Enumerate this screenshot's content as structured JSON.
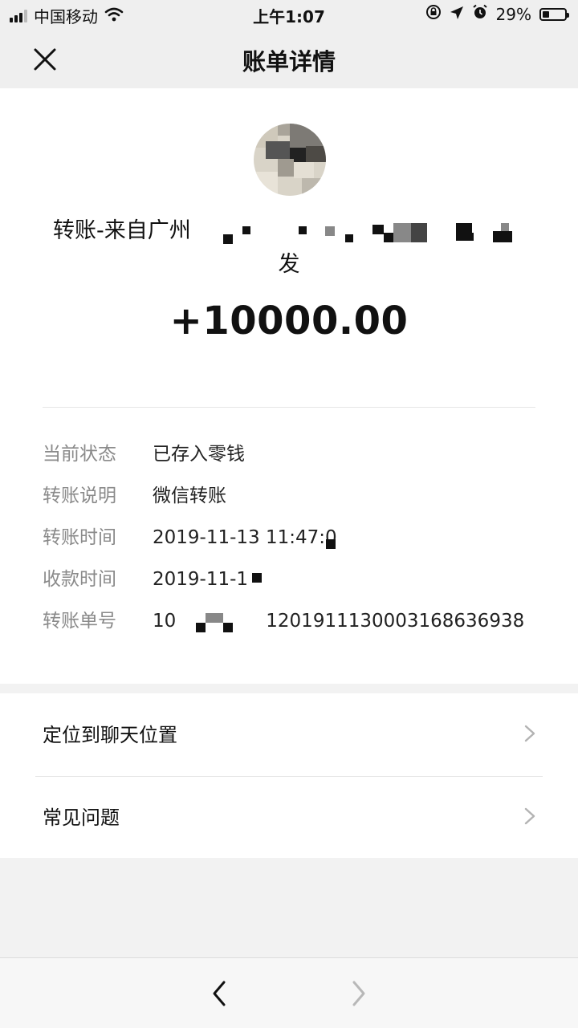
{
  "status_bar": {
    "carrier": "中国移动",
    "time": "上午1:07",
    "battery_percent": "29%",
    "battery_level": 0.29
  },
  "header": {
    "title": "账单详情"
  },
  "transfer": {
    "sender_visible": "转账-来自广州",
    "sender_line2": "发",
    "amount": "+10000.00"
  },
  "details": [
    {
      "label": "当前状态",
      "value": "已存入零钱"
    },
    {
      "label": "转账说明",
      "value": "微信转账"
    },
    {
      "label": "转账时间",
      "value": "2019-11-13 11:47:0"
    },
    {
      "label": "收款时间",
      "value": "2019-11-1"
    },
    {
      "label": "转账单号",
      "value_prefix": "10",
      "value_suffix": "1201911130003168636938"
    }
  ],
  "menu": [
    {
      "label": "定位到聊天位置"
    },
    {
      "label": "常见问题"
    }
  ],
  "colors": {
    "background": "#f2f2f2",
    "card": "#ffffff",
    "label_gray": "#8a8a8a",
    "text": "#111111"
  },
  "icons": [
    "signal-icon",
    "wifi-icon",
    "lock-rotation-icon",
    "location-icon",
    "alarm-icon",
    "battery-icon",
    "close-icon",
    "chevron-right-icon",
    "back-arrow-icon",
    "forward-arrow-icon"
  ]
}
